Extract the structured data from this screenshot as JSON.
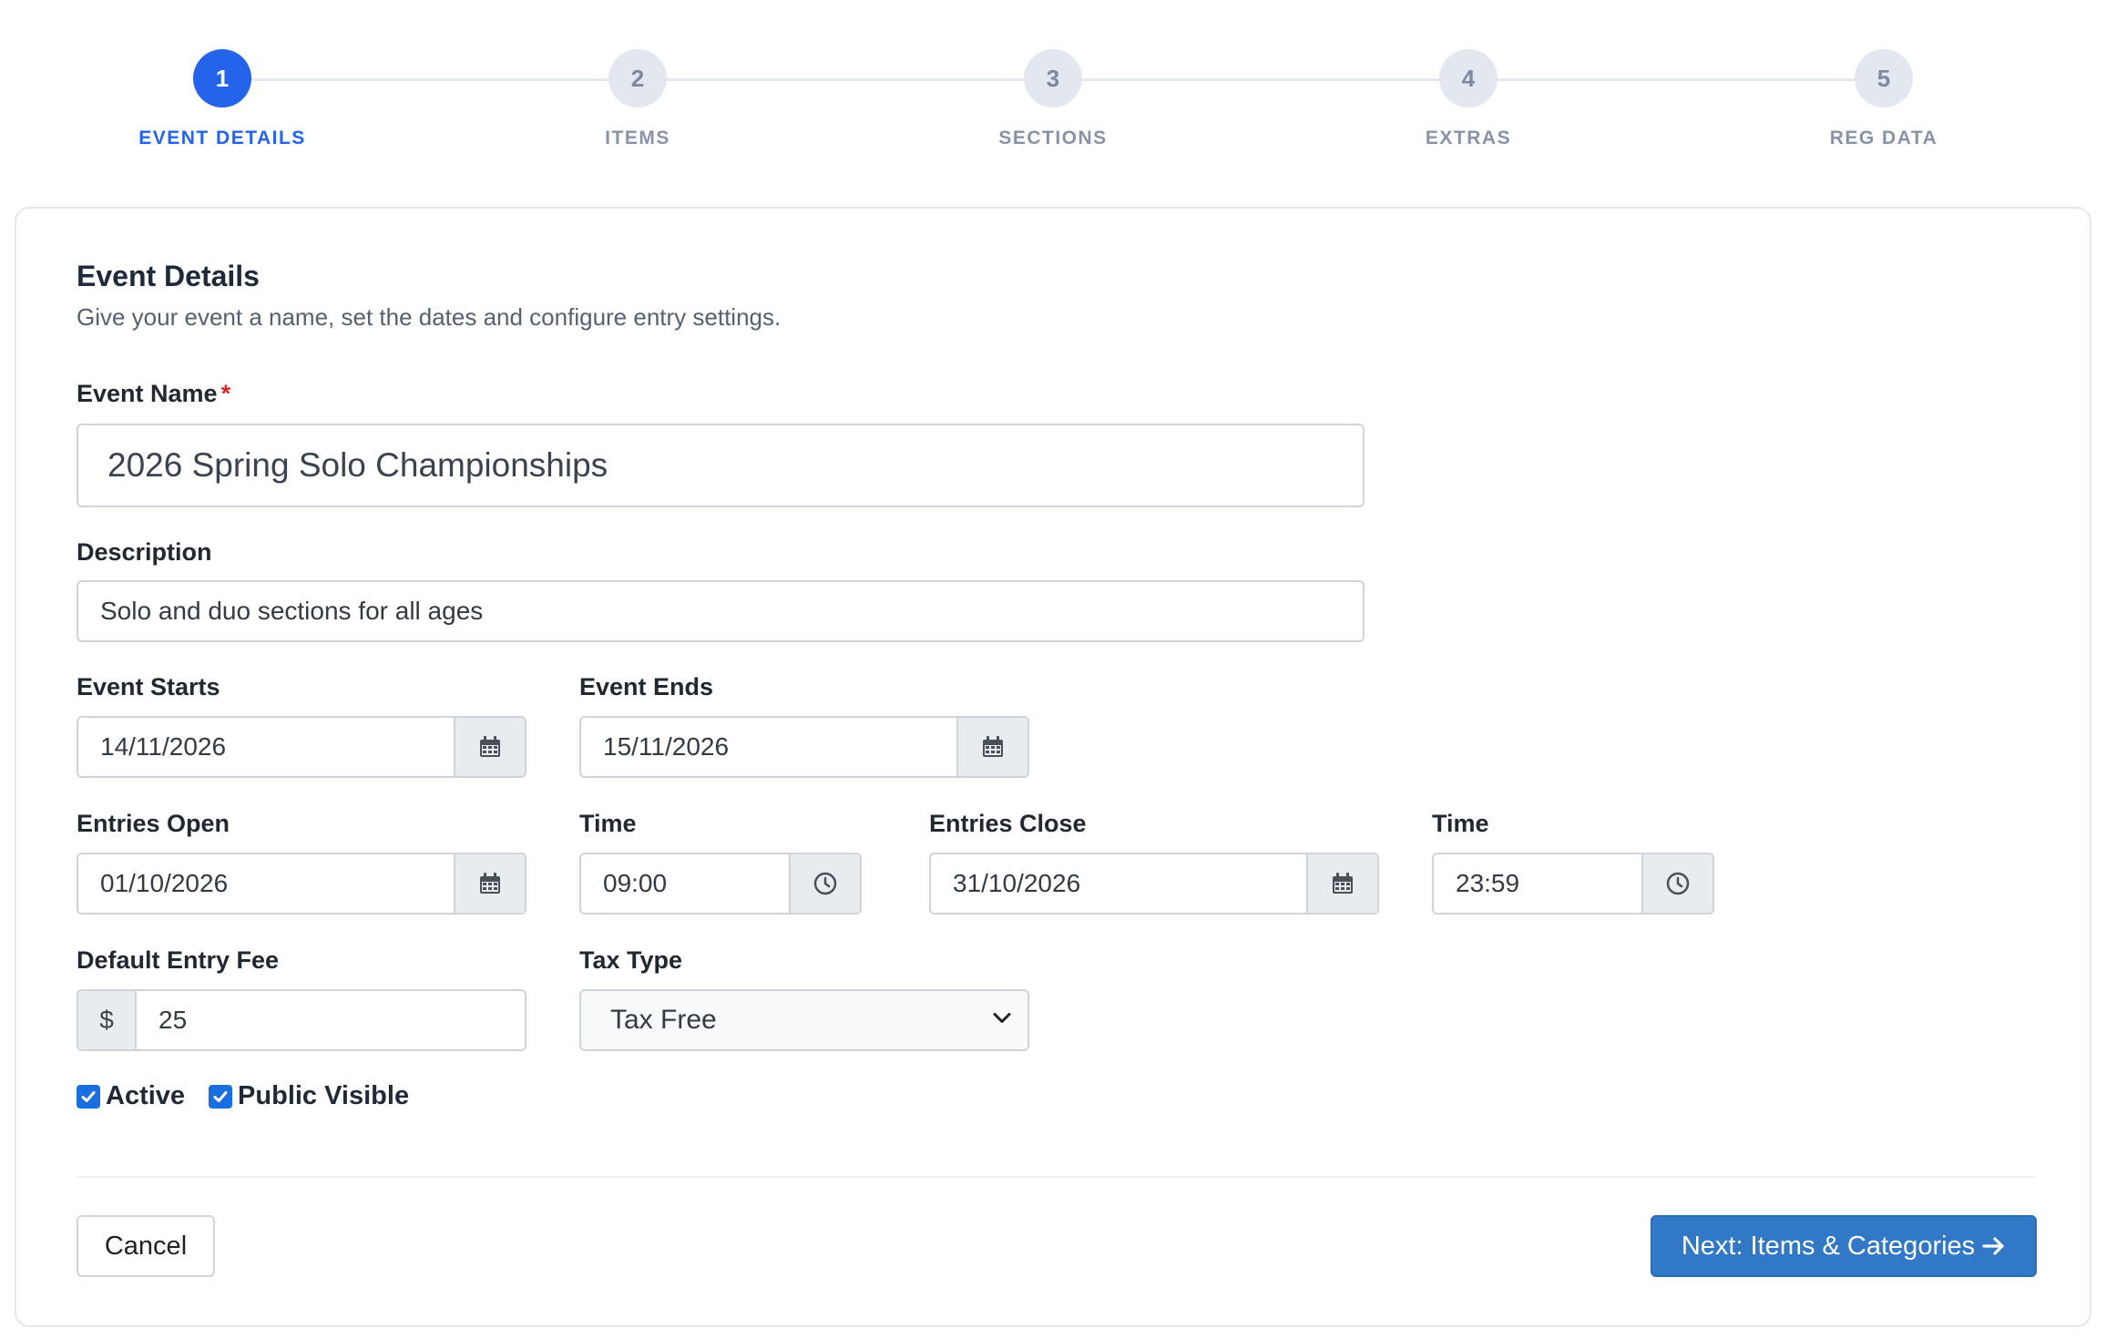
{
  "stepper": {
    "steps": [
      {
        "number": "1",
        "label": "EVENT DETAILS",
        "active": true
      },
      {
        "number": "2",
        "label": "ITEMS",
        "active": false
      },
      {
        "number": "3",
        "label": "SECTIONS",
        "active": false
      },
      {
        "number": "4",
        "label": "EXTRAS",
        "active": false
      },
      {
        "number": "5",
        "label": "REG DATA",
        "active": false
      }
    ]
  },
  "card": {
    "title": "Event Details",
    "subtitle": "Give your event a name, set the dates and configure entry settings."
  },
  "form": {
    "event_name": {
      "label": "Event Name",
      "required_mark": "*",
      "value": "2026 Spring Solo Championships"
    },
    "description": {
      "label": "Description",
      "value": "Solo and duo sections for all ages"
    },
    "event_starts": {
      "label": "Event Starts",
      "value": "14/11/2026"
    },
    "event_ends": {
      "label": "Event Ends",
      "value": "15/11/2026"
    },
    "entries_open": {
      "label": "Entries Open",
      "value": "01/10/2026"
    },
    "entries_open_time": {
      "label": "Time",
      "value": "09:00"
    },
    "entries_close": {
      "label": "Entries Close",
      "value": "31/10/2026"
    },
    "entries_close_time": {
      "label": "Time",
      "value": "23:59"
    },
    "default_entry_fee": {
      "label": "Default Entry Fee",
      "prefix": "$",
      "value": "25"
    },
    "tax_type": {
      "label": "Tax Type",
      "value": "Tax Free"
    },
    "active": {
      "label": "Active",
      "checked": true
    },
    "public_visible": {
      "label": "Public Visible",
      "checked": true
    }
  },
  "actions": {
    "cancel_label": "Cancel",
    "next_label": "Next: Items & Categories"
  },
  "icons": {
    "date": "calendar-icon",
    "time": "clock-icon",
    "select": "chevron-down-icon",
    "next": "arrow-right-icon"
  },
  "colors": {
    "primary": "#2563eb",
    "next_button": "#3178c6",
    "checkbox": "#1a6fe0",
    "required": "#dc2626"
  }
}
